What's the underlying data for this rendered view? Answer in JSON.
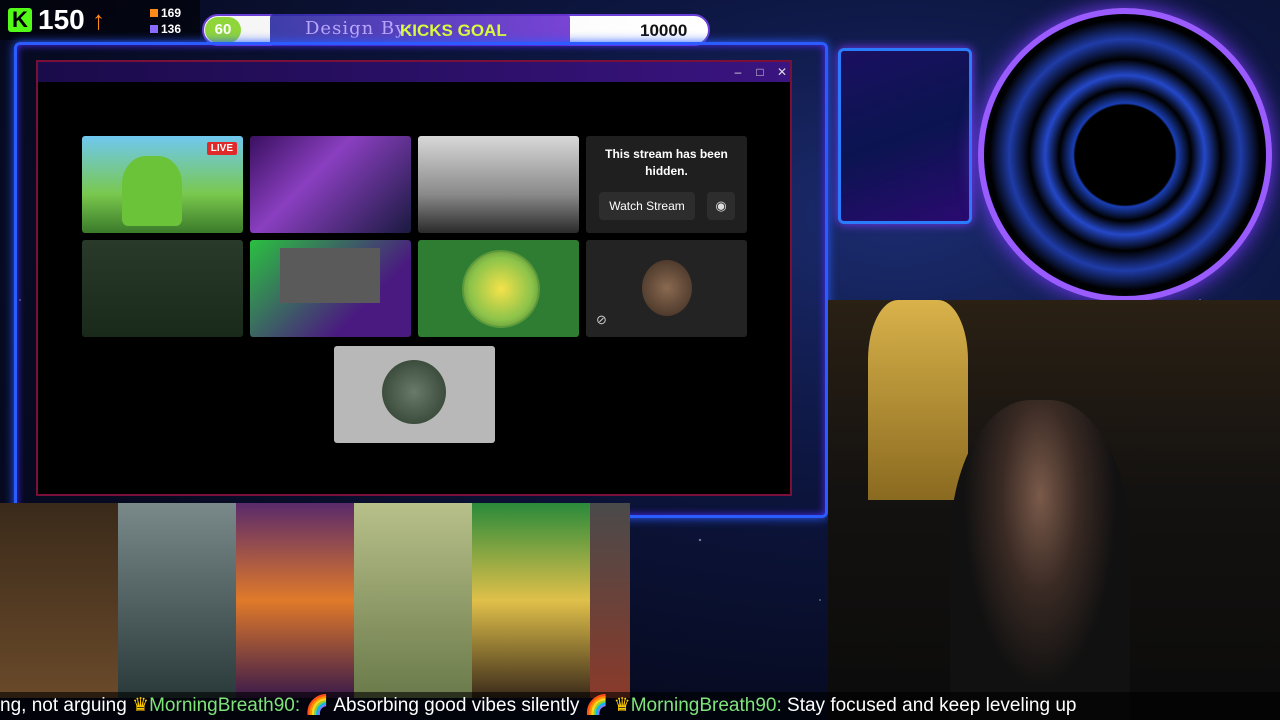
{
  "hud": {
    "kick_count": "150",
    "stat_1": "169",
    "stat_2": "136",
    "goal_level": "60",
    "goal_design_label": "Design By:",
    "goal_label": "KICKS GOAL",
    "goal_target": "10000"
  },
  "window": {
    "controls": {
      "minimize": "–",
      "maximize": "□",
      "close": "✕"
    },
    "tiles": [
      {
        "live_badge": "LIVE"
      },
      {},
      {},
      {
        "hidden_text": "This stream has been hidden.",
        "watch_label": "Watch Stream"
      },
      {},
      {},
      {},
      {},
      {}
    ]
  },
  "ticker": {
    "part1": "ng, not arguing",
    "name1": "MorningBreath90:",
    "msg1": "Absorbing good vibes silently",
    "name2": "MorningBreath90:",
    "msg2": "Stay focused and keep leveling up"
  },
  "colors": {
    "kick_green": "#53fc18",
    "goal_bar_purple": "#6a3fd8",
    "frame_blue": "#2b5cff",
    "live_red": "#e02a2a"
  }
}
